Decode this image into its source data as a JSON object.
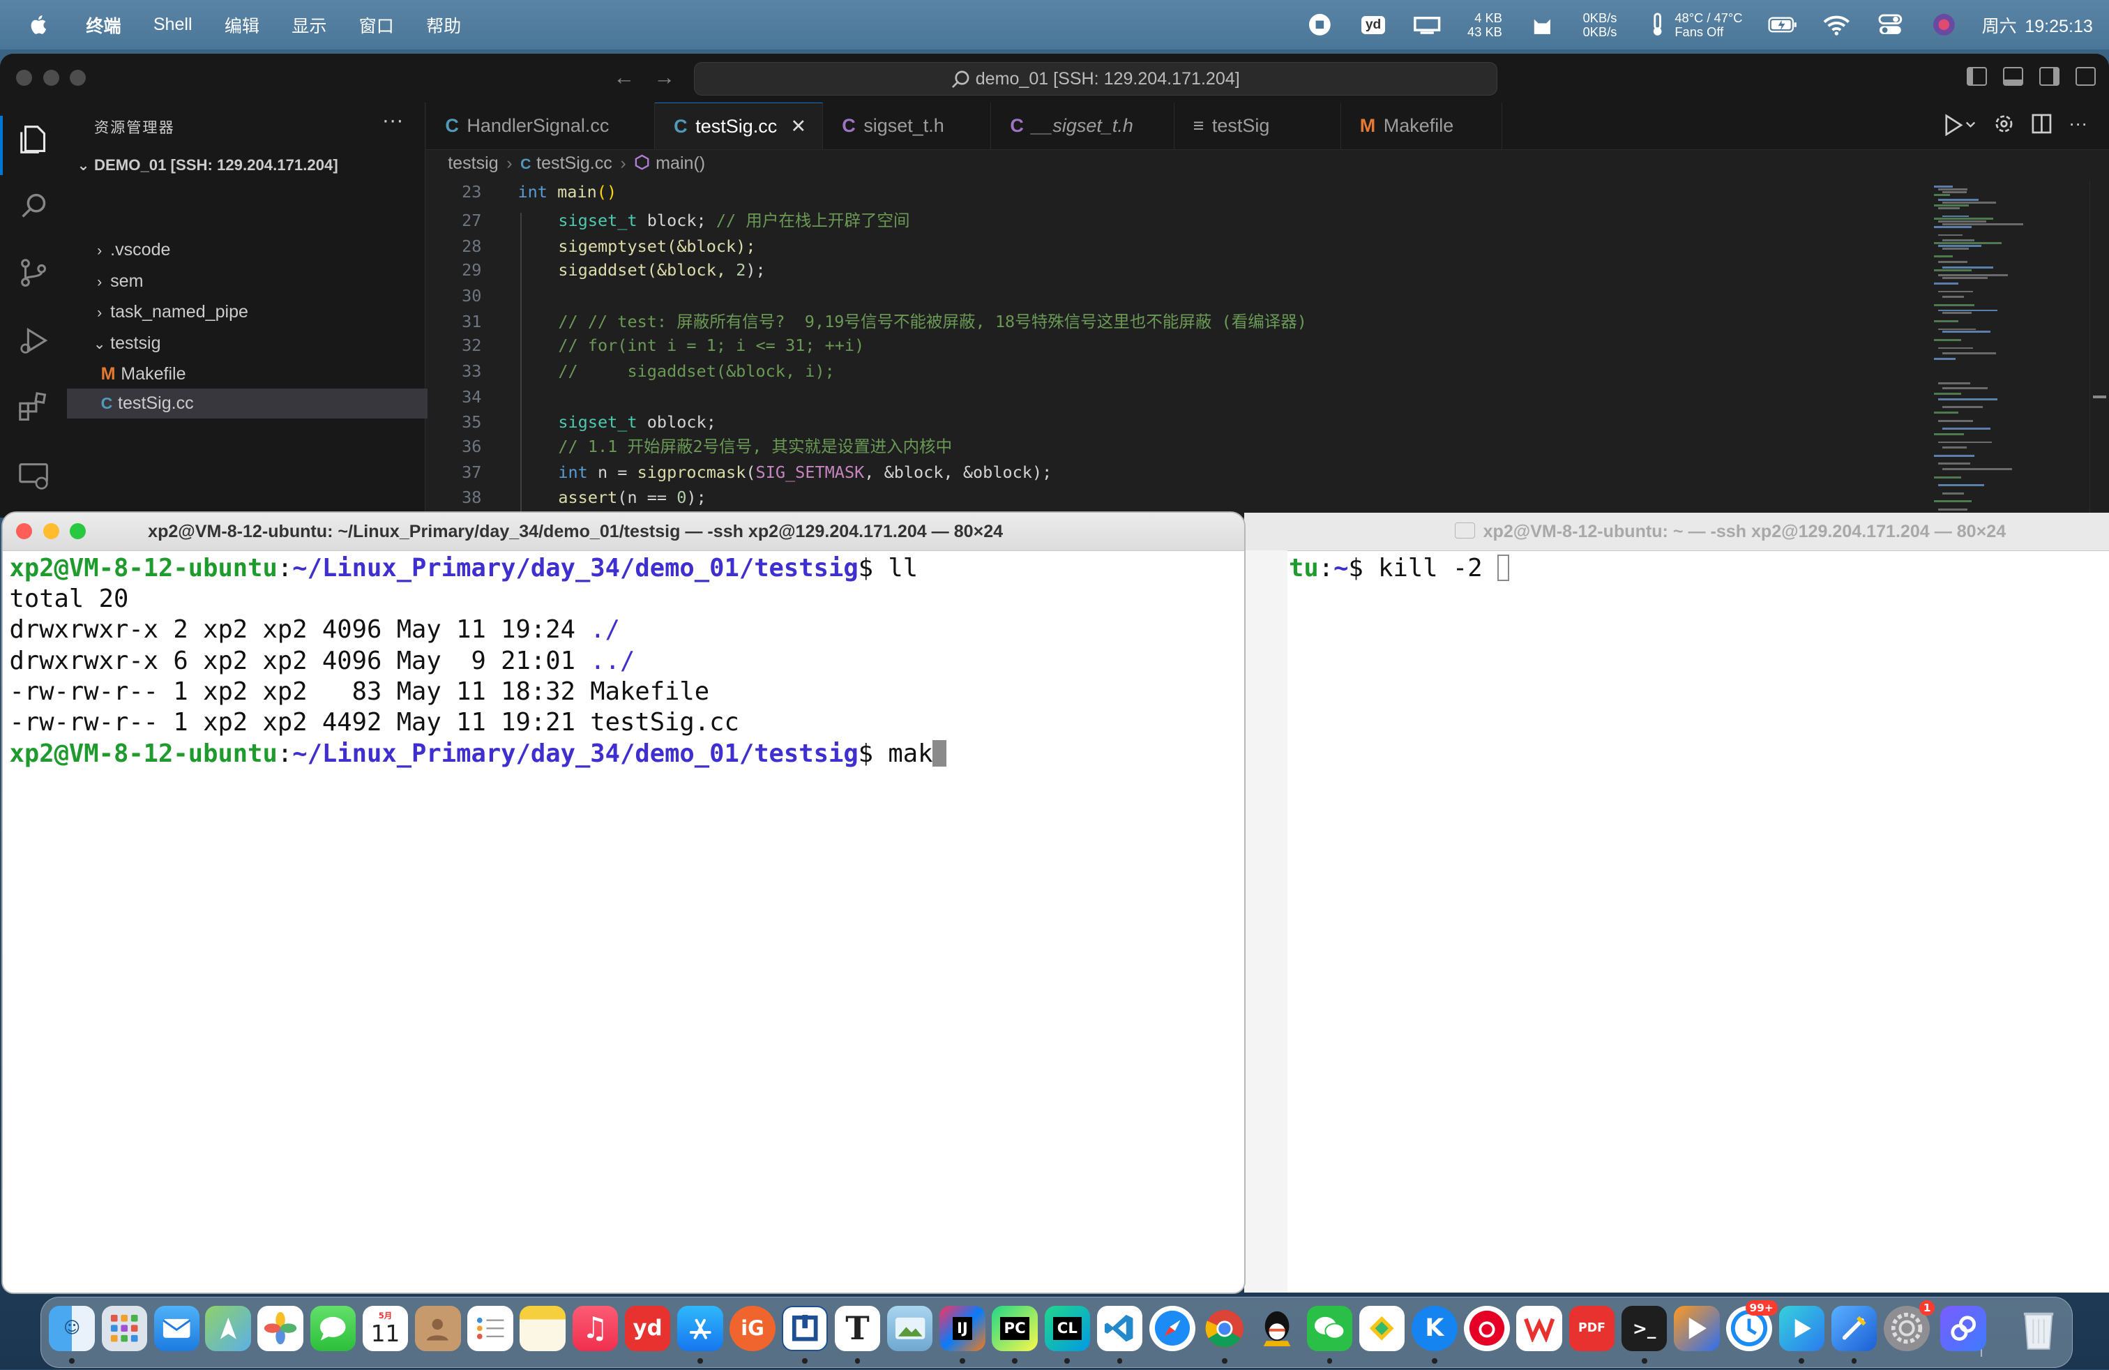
{
  "menubar": {
    "menus": [
      "终端",
      "Shell",
      "编辑",
      "显示",
      "窗口",
      "帮助"
    ],
    "net_up": "4 KB",
    "net_down": "43 KB",
    "disk_read": "0KB/s",
    "disk_write": "0KB/s",
    "temp": "48°C / 47°C",
    "fans": "Fans Off",
    "yd": "yd",
    "day": "周六",
    "time": "19:25:13"
  },
  "vscode": {
    "command_center": "demo_01 [SSH: 129.204.171.204]",
    "explorer_title": "资源管理器",
    "explorer_more": "···",
    "root_label": "DEMO_01 [SSH: 129.204.171.204]",
    "tree": [
      {
        "label": ".vscode",
        "chevron": "›"
      },
      {
        "label": "sem",
        "chevron": "›"
      },
      {
        "label": "task_named_pipe",
        "chevron": "›"
      },
      {
        "label": "testsig",
        "chevron": "⌄"
      },
      {
        "label": "Makefile",
        "icon": "M"
      },
      {
        "label": "testSig.cc",
        "icon": "C"
      }
    ],
    "tabs": [
      {
        "label": "HandlerSignal.cc",
        "icon": "C"
      },
      {
        "label": "testSig.cc",
        "icon": "C",
        "close": "✕"
      },
      {
        "label": "sigset_t.h",
        "icon": "C"
      },
      {
        "label": "__sigset_t.h",
        "icon": "C"
      },
      {
        "label": "testSig",
        "icon": "≡"
      },
      {
        "label": "Makefile",
        "icon": "M"
      }
    ],
    "breadcrumb": [
      "testsig",
      "testSig.cc",
      "main()"
    ],
    "code_lines": [
      {
        "n": "23"
      },
      {
        "n": "27"
      },
      {
        "n": "28"
      },
      {
        "n": "29"
      },
      {
        "n": "30"
      },
      {
        "n": "31"
      },
      {
        "n": "32"
      },
      {
        "n": "33"
      },
      {
        "n": "34"
      },
      {
        "n": "35"
      },
      {
        "n": "36"
      },
      {
        "n": "37"
      },
      {
        "n": "38"
      }
    ],
    "code": {
      "l23_kw": "int",
      "l23_fn": "main",
      "l27_ty": "sigset_t",
      "l27_rest": " block; ",
      "l27_cm": "// 用户在栈上开辟了空间",
      "l28": "sigemptyset(&block);",
      "l29_a": "sigaddset(&block, ",
      "l29_n": "2",
      "l29_b": ");",
      "l31_cm": "// // test: 屏蔽所有信号?  9,19号信号不能被屏蔽, 18号特殊信号这里也不能屏蔽 (看编译器)",
      "l32_cm": "// for(int i = 1; i <= 31; ++i)",
      "l33_cm": "//     sigaddset(&block, i);",
      "l35_ty": "sigset_t",
      "l35_rest": " oblock;",
      "l36_cm": "// 1.1 开始屏蔽2号信号, 其实就是设置进入内核中",
      "l37_kw": "int",
      "l37_a": " n = ",
      "l37_fn": "sigprocmask",
      "l37_mac": "SIG_SETMASK",
      "l37_b": ", &block, &oblock);",
      "l38_fn": "assert",
      "l38_a": "(n == ",
      "l38_n": "0",
      "l38_b": ");"
    }
  },
  "terminal_left": {
    "title": "xp2@VM-8-12-ubuntu: ~/Linux_Primary/day_34/demo_01/testsig — -ssh xp2@129.204.171.204 — 80×24",
    "prompt_user": "xp2@VM-8-12-ubuntu",
    "prompt_path": "~/Linux_Primary/day_34/demo_01/testsig",
    "cmd1": "ll",
    "lines": [
      "total 20",
      "drwxrwxr-x 2 xp2 xp2 4096 May 11 19:24 ",
      "drwxrwxr-x 6 xp2 xp2 4096 May  9 21:01 ",
      "-rw-rw-r-- 1 xp2 xp2   83 May 11 18:32 Makefile",
      "-rw-rw-r-- 1 xp2 xp2 4492 May 11 19:21 testSig.cc"
    ],
    "dir1": "./",
    "dir2": "../",
    "cmd2": "mak"
  },
  "terminal_right": {
    "title": "xp2@VM-8-12-ubuntu: ~ — -ssh xp2@129.204.171.204 — 80×24",
    "prompt_tail": "buntu",
    "prompt_path": "~",
    "cmd": "kill -2 "
  },
  "dock": {
    "calendar_month": "5月",
    "calendar_day": "11",
    "badge_99": "99+",
    "badge_1": "1",
    "apps": [
      "finder-icon",
      "launchpad-icon",
      "mail-icon",
      "maps-icon",
      "photos-icon",
      "messages-icon",
      "calendar-icon",
      "contacts-icon",
      "reminders-icon",
      "notes-icon",
      "music-icon",
      "youdao-icon",
      "app-store-icon",
      "git-client-icon",
      "sourcetree-icon",
      "typora-icon",
      "preview-icon",
      "intellij-icon",
      "pycharm-icon",
      "clion-icon",
      "vscode-icon",
      "safari-icon",
      "chrome-icon",
      "qq-icon",
      "wechat-icon",
      "tencent-meeting-icon",
      "kuwo-icon",
      "netease-music-icon",
      "wps-icon",
      "pdf-icon",
      "terminal-icon",
      "infuse-icon",
      "update-icon",
      "quicktime-icon",
      "xcode-icon",
      "system-settings-icon",
      "shortcuts-icon",
      "trash-icon"
    ]
  },
  "colors": {
    "prompt_user": "#1f9a2d",
    "prompt_path": "#3f2fcf",
    "vscode_bg": "#1f1f1f",
    "accent": "#0078d4"
  }
}
